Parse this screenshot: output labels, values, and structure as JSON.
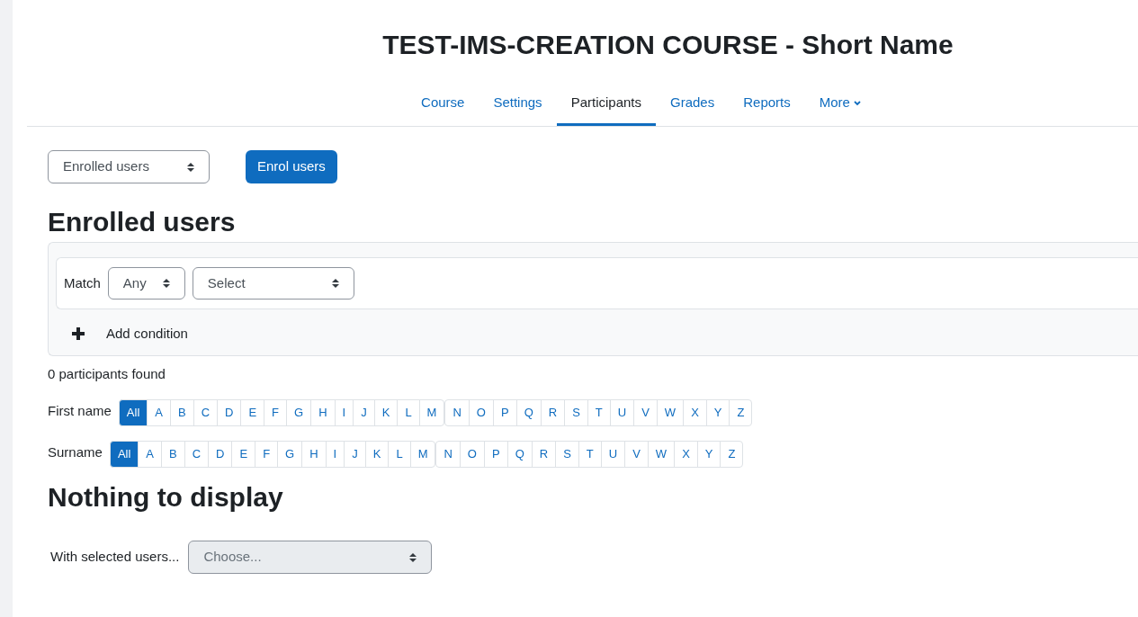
{
  "course_title": "TEST-IMS-CREATION COURSE - Short Name",
  "nav_tabs": [
    {
      "label": "Course",
      "selected": false,
      "kind": "link"
    },
    {
      "label": "Settings",
      "selected": false,
      "kind": "link"
    },
    {
      "label": "Participants",
      "selected": true,
      "kind": "link"
    },
    {
      "label": "Grades",
      "selected": false,
      "kind": "link"
    },
    {
      "label": "Reports",
      "selected": false,
      "kind": "link"
    },
    {
      "label": "More",
      "selected": false,
      "kind": "dropdown"
    }
  ],
  "view_select": {
    "value": "Enrolled users"
  },
  "enrol_button": "Enrol users",
  "heading": "Enrolled users",
  "filter": {
    "match_label": "Match",
    "match_value": "Any",
    "condition_value": "Select",
    "add_condition": "Add condition"
  },
  "result_count": "0 participants found",
  "initial_bars": [
    {
      "label": "First name",
      "groups": [
        [
          {
            "label": "All",
            "selected": true
          },
          {
            "label": "A",
            "selected": false
          },
          {
            "label": "B",
            "selected": false
          },
          {
            "label": "C",
            "selected": false
          },
          {
            "label": "D",
            "selected": false
          },
          {
            "label": "E",
            "selected": false
          },
          {
            "label": "F",
            "selected": false
          },
          {
            "label": "G",
            "selected": false
          },
          {
            "label": "H",
            "selected": false
          },
          {
            "label": "I",
            "selected": false
          },
          {
            "label": "J",
            "selected": false
          },
          {
            "label": "K",
            "selected": false
          },
          {
            "label": "L",
            "selected": false
          },
          {
            "label": "M",
            "selected": false
          }
        ],
        [
          {
            "label": "N",
            "selected": false
          },
          {
            "label": "O",
            "selected": false
          },
          {
            "label": "P",
            "selected": false
          },
          {
            "label": "Q",
            "selected": false
          },
          {
            "label": "R",
            "selected": false
          },
          {
            "label": "S",
            "selected": false
          },
          {
            "label": "T",
            "selected": false
          },
          {
            "label": "U",
            "selected": false
          },
          {
            "label": "V",
            "selected": false
          },
          {
            "label": "W",
            "selected": false
          },
          {
            "label": "X",
            "selected": false
          },
          {
            "label": "Y",
            "selected": false
          },
          {
            "label": "Z",
            "selected": false
          }
        ]
      ]
    },
    {
      "label": "Surname",
      "groups": [
        [
          {
            "label": "All",
            "selected": true
          },
          {
            "label": "A",
            "selected": false
          },
          {
            "label": "B",
            "selected": false
          },
          {
            "label": "C",
            "selected": false
          },
          {
            "label": "D",
            "selected": false
          },
          {
            "label": "E",
            "selected": false
          },
          {
            "label": "F",
            "selected": false
          },
          {
            "label": "G",
            "selected": false
          },
          {
            "label": "H",
            "selected": false
          },
          {
            "label": "I",
            "selected": false
          },
          {
            "label": "J",
            "selected": false
          },
          {
            "label": "K",
            "selected": false
          },
          {
            "label": "L",
            "selected": false
          },
          {
            "label": "M",
            "selected": false
          }
        ],
        [
          {
            "label": "N",
            "selected": false
          },
          {
            "label": "O",
            "selected": false
          },
          {
            "label": "P",
            "selected": false
          },
          {
            "label": "Q",
            "selected": false
          },
          {
            "label": "R",
            "selected": false
          },
          {
            "label": "S",
            "selected": false
          },
          {
            "label": "T",
            "selected": false
          },
          {
            "label": "U",
            "selected": false
          },
          {
            "label": "V",
            "selected": false
          },
          {
            "label": "W",
            "selected": false
          },
          {
            "label": "X",
            "selected": false
          },
          {
            "label": "Y",
            "selected": false
          },
          {
            "label": "Z",
            "selected": false
          }
        ]
      ]
    }
  ],
  "empty_heading": "Nothing to display",
  "bulk_action": {
    "label": "With selected users...",
    "placeholder": "Choose...",
    "disabled": true
  }
}
